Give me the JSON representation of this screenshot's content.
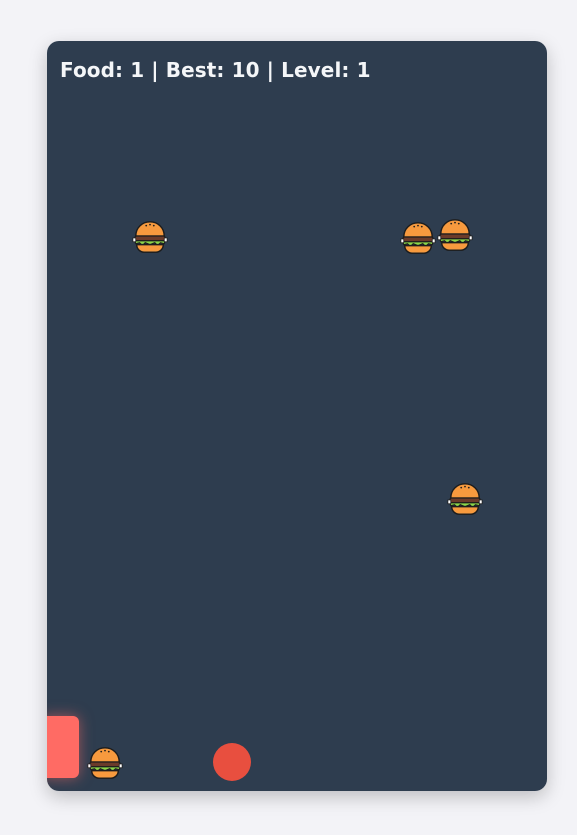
{
  "hud": {
    "text": "Food: 1 | Best: 10 | Level: 1"
  },
  "items": [
    {
      "icon": "burger-icon"
    },
    {
      "icon": "burger-icon"
    },
    {
      "icon": "burger-icon"
    },
    {
      "icon": "burger-icon"
    },
    {
      "icon": "burger-icon"
    }
  ],
  "colors": {
    "page_background": "#f3f3f7",
    "board_background": "#2e3d4f",
    "hud_text": "#f4f6f8",
    "paddle": "#ff6b64",
    "ball": "#e84f3f",
    "bun": "#f79a3e",
    "patty": "#6b3b2a",
    "lettuce": "#8bd64a"
  }
}
